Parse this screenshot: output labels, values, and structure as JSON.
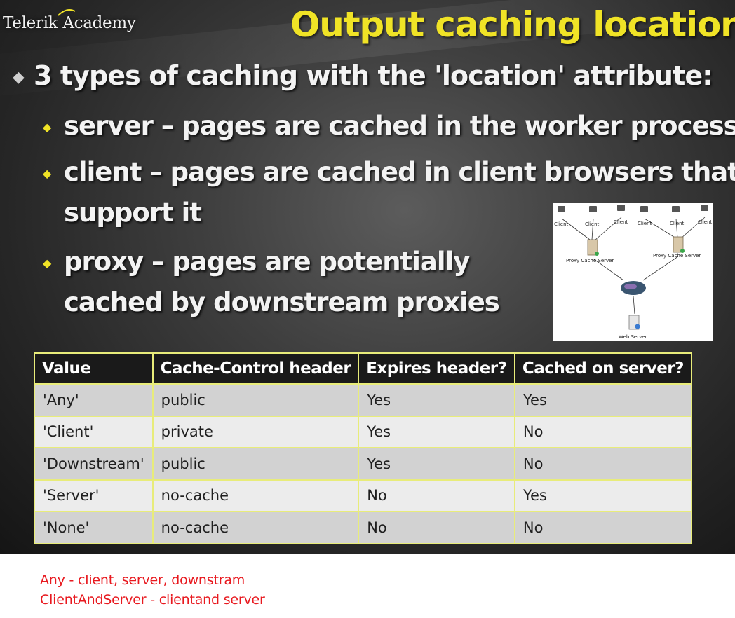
{
  "slide": {
    "logo": "Telerik Academy",
    "title": "Output caching location",
    "bullet_main": "3 types of caching with the 'location' attribute:",
    "sub_bullets": [
      {
        "lines": [
          "server – pages are cached in the worker process"
        ]
      },
      {
        "lines": [
          "client – pages are cached in client browsers that",
          "support it"
        ]
      },
      {
        "lines": [
          "proxy – pages are potentially",
          "cached by downstream proxies"
        ]
      }
    ],
    "diagram": {
      "client_labels": [
        "Client",
        "Client",
        "Client",
        "Client",
        "Client",
        "Client"
      ],
      "proxy_left": "Proxy Cache Server",
      "proxy_right": "Proxy Cache Server",
      "web_server": "Web Server"
    },
    "table": {
      "headers": [
        "Value",
        "Cache-Control header",
        "Expires header?",
        "Cached on server?"
      ],
      "rows": [
        [
          "'Any'",
          "public",
          "Yes",
          "Yes"
        ],
        [
          "'Client'",
          "private",
          "Yes",
          "No"
        ],
        [
          "'Downstream'",
          "public",
          "Yes",
          "No"
        ],
        [
          "'Server'",
          "no-cache",
          "No",
          "Yes"
        ],
        [
          "'None'",
          "no-cache",
          "No",
          "No"
        ]
      ]
    }
  },
  "notes": [
    "Any - client, server, downstram",
    "ClientAndServer - clientand server"
  ],
  "colors": {
    "title": "#f0e326",
    "table_border": "#e8ec7a",
    "note": "#e8191f"
  }
}
